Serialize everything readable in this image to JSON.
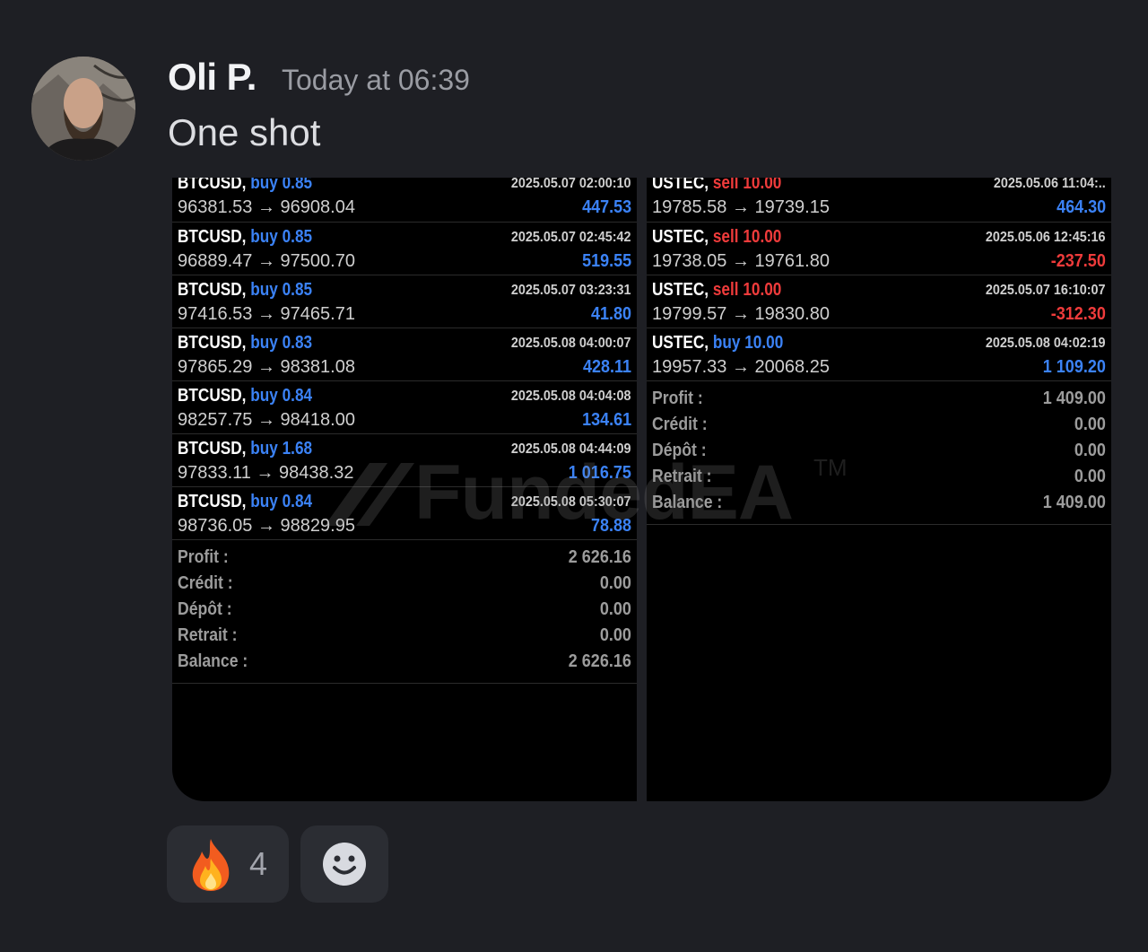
{
  "message": {
    "author": "Oli P.",
    "timestamp": "Today at 06:39",
    "text": "One shot"
  },
  "left_panel": {
    "trades": [
      {
        "symbol": "BTCUSD,",
        "side": "buy",
        "volume": "0.85",
        "date": "2025.05.07 02:00:10",
        "prices": "96381.53 → 96908.04",
        "pl": "447.53",
        "pl_sign": "pos"
      },
      {
        "symbol": "BTCUSD,",
        "side": "buy",
        "volume": "0.85",
        "date": "2025.05.07 02:45:42",
        "prices": "96889.47 → 97500.70",
        "pl": "519.55",
        "pl_sign": "pos"
      },
      {
        "symbol": "BTCUSD,",
        "side": "buy",
        "volume": "0.85",
        "date": "2025.05.07 03:23:31",
        "prices": "97416.53 → 97465.71",
        "pl": "41.80",
        "pl_sign": "pos"
      },
      {
        "symbol": "BTCUSD,",
        "side": "buy",
        "volume": "0.83",
        "date": "2025.05.08 04:00:07",
        "prices": "97865.29 → 98381.08",
        "pl": "428.11",
        "pl_sign": "pos"
      },
      {
        "symbol": "BTCUSD,",
        "side": "buy",
        "volume": "0.84",
        "date": "2025.05.08 04:04:08",
        "prices": "98257.75 → 98418.00",
        "pl": "134.61",
        "pl_sign": "pos"
      },
      {
        "symbol": "BTCUSD,",
        "side": "buy",
        "volume": "1.68",
        "date": "2025.05.08 04:44:09",
        "prices": "97833.11 → 98438.32",
        "pl": "1 016.75",
        "pl_sign": "pos"
      },
      {
        "symbol": "BTCUSD,",
        "side": "buy",
        "volume": "0.84",
        "date": "2025.05.08 05:30:07",
        "prices": "98736.05 → 98829.95",
        "pl": "78.88",
        "pl_sign": "pos"
      }
    ],
    "summary": [
      {
        "label": "Profit :",
        "value": "2 626.16"
      },
      {
        "label": "Crédit :",
        "value": "0.00"
      },
      {
        "label": "Dépôt :",
        "value": "0.00"
      },
      {
        "label": "Retrait :",
        "value": "0.00"
      },
      {
        "label": "Balance :",
        "value": "2 626.16"
      }
    ]
  },
  "right_panel": {
    "trades": [
      {
        "symbol": "USTEC,",
        "side": "sell",
        "volume": "10.00",
        "date": "2025.05.06 11:04:..",
        "prices": "19785.58 → 19739.15",
        "pl": "464.30",
        "pl_sign": "pos"
      },
      {
        "symbol": "USTEC,",
        "side": "sell",
        "volume": "10.00",
        "date": "2025.05.06 12:45:16",
        "prices": "19738.05 → 19761.80",
        "pl": "-237.50",
        "pl_sign": "neg"
      },
      {
        "symbol": "USTEC,",
        "side": "sell",
        "volume": "10.00",
        "date": "2025.05.07 16:10:07",
        "prices": "19799.57 → 19830.80",
        "pl": "-312.30",
        "pl_sign": "neg"
      },
      {
        "symbol": "USTEC,",
        "side": "buy",
        "volume": "10.00",
        "date": "2025.05.08 04:02:19",
        "prices": "19957.33 → 20068.25",
        "pl": "1 109.20",
        "pl_sign": "pos"
      }
    ],
    "summary": [
      {
        "label": "Profit :",
        "value": "1 409.00"
      },
      {
        "label": "Crédit :",
        "value": "0.00"
      },
      {
        "label": "Dépôt :",
        "value": "0.00"
      },
      {
        "label": "Retrait :",
        "value": "0.00"
      },
      {
        "label": "Balance :",
        "value": "1 409.00"
      }
    ]
  },
  "watermark": {
    "text": "FundedEA",
    "tm": "TM"
  },
  "reactions": [
    {
      "icon": "fire-emoji-icon",
      "count": "4"
    },
    {
      "icon": "add-reaction-smiley-icon"
    }
  ],
  "colors": {
    "buy": "#3b82f6",
    "sell": "#ef3b3b",
    "background": "#1e1f24"
  }
}
